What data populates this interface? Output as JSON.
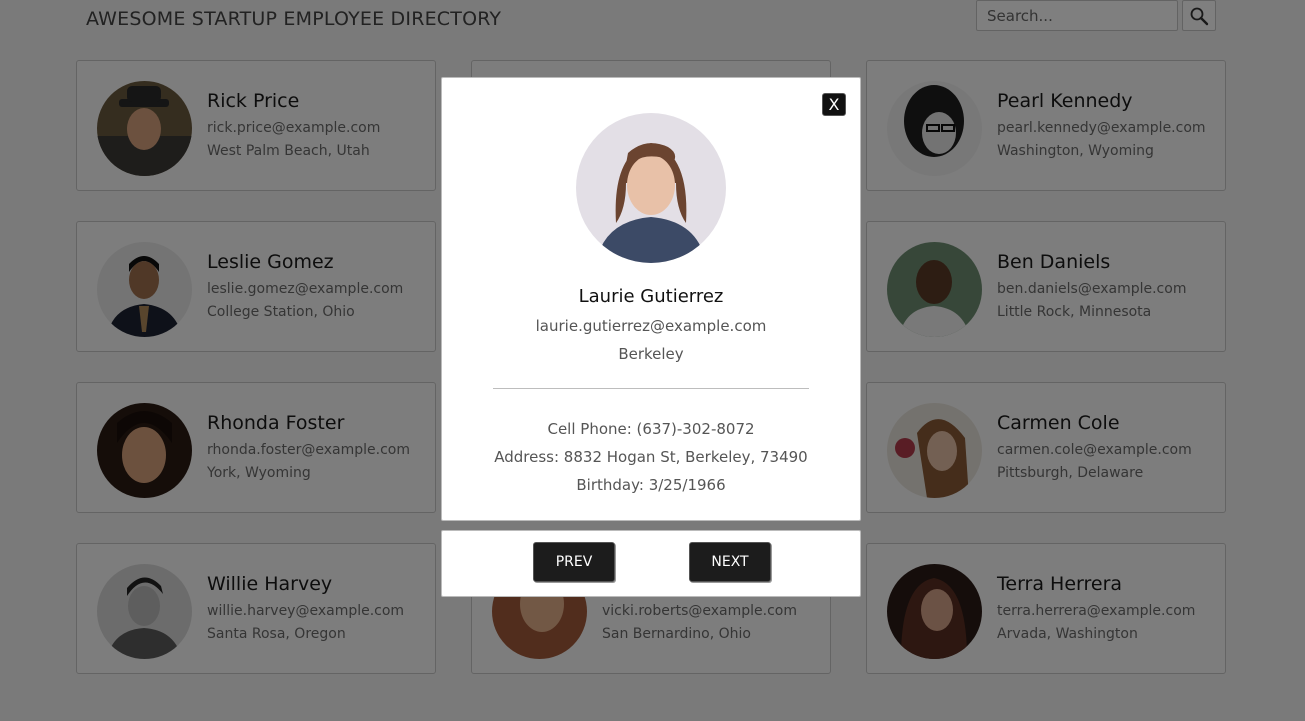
{
  "header": {
    "title": "AWESOME STARTUP EMPLOYEE DIRECTORY",
    "search_placeholder": "Search..."
  },
  "employees": [
    {
      "name": "Rick Price",
      "email": "rick.price@example.com",
      "location": "West Palm Beach, Utah"
    },
    {
      "name": "",
      "email": "",
      "location": ""
    },
    {
      "name": "Pearl Kennedy",
      "email": "pearl.kennedy@example.com",
      "location": "Washington, Wyoming"
    },
    {
      "name": "Leslie Gomez",
      "email": "leslie.gomez@example.com",
      "location": "College Station, Ohio"
    },
    {
      "name": "",
      "email": "",
      "location": ""
    },
    {
      "name": "Ben Daniels",
      "email": "ben.daniels@example.com",
      "location": "Little Rock, Minnesota"
    },
    {
      "name": "Rhonda Foster",
      "email": "rhonda.foster@example.com",
      "location": "York, Wyoming"
    },
    {
      "name": "",
      "email": "",
      "location": ""
    },
    {
      "name": "Carmen Cole",
      "email": "carmen.cole@example.com",
      "location": "Pittsburgh, Delaware"
    },
    {
      "name": "Willie Harvey",
      "email": "willie.harvey@example.com",
      "location": "Santa Rosa, Oregon"
    },
    {
      "name": "",
      "email": "vicki.roberts@example.com",
      "location": "San Bernardino, Ohio"
    },
    {
      "name": "Terra Herrera",
      "email": "terra.herrera@example.com",
      "location": "Arvada, Washington"
    }
  ],
  "modal": {
    "close_label": "X",
    "name": "Laurie Gutierrez",
    "email": "laurie.gutierrez@example.com",
    "city": "Berkeley",
    "phone": "Cell Phone: (637)-302-8072",
    "address": "Address: 8832 Hogan St, Berkeley, 73490",
    "birthday": "Birthday: 3/25/1966",
    "prev_label": "PREV",
    "next_label": "NEXT"
  }
}
